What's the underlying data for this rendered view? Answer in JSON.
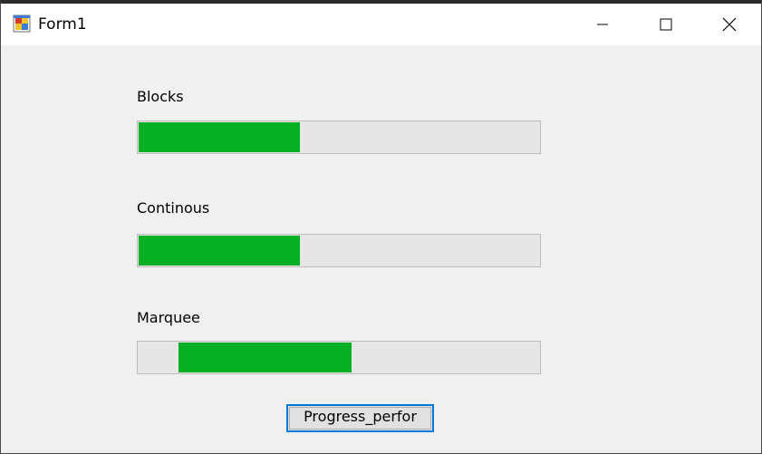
{
  "window": {
    "title": "Form1",
    "icon": "form-app-icon",
    "controls": {
      "minimize": "minimize-icon",
      "maximize": "maximize-icon",
      "close": "close-icon"
    }
  },
  "progress_bars": [
    {
      "label": "Blocks",
      "value": 0.4,
      "style": "blocks"
    },
    {
      "label": "Continous",
      "value": 0.4,
      "style": "continuous"
    },
    {
      "label": "Marquee",
      "marquee_start": 0.1,
      "marquee_end": 0.53,
      "style": "marquee"
    }
  ],
  "button": {
    "label": "Progress_perfor"
  },
  "colors": {
    "progress_fill": "#06b025",
    "progress_track": "#e6e6e6",
    "button_focus_border": "#0078d7",
    "client_background": "#f0f0f0"
  }
}
